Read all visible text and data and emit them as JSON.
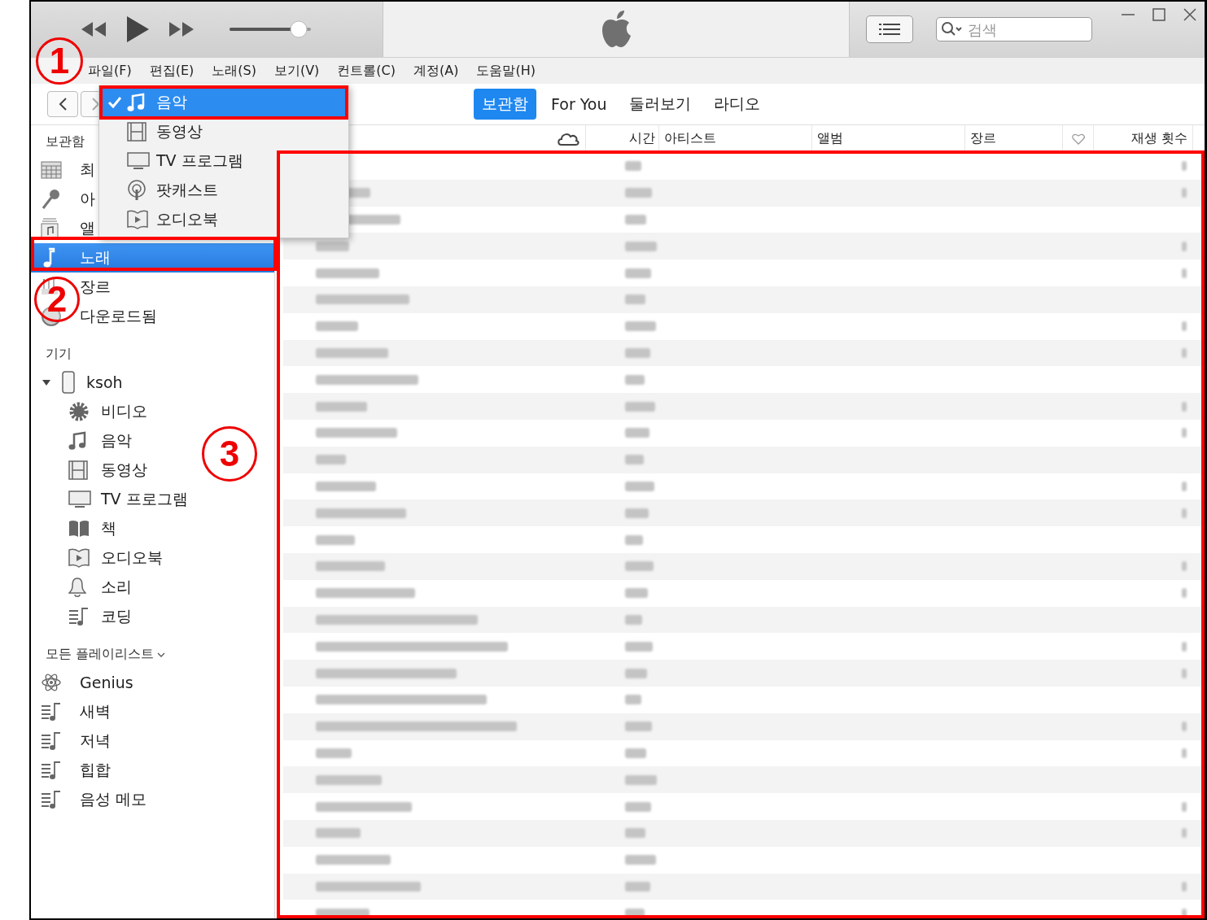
{
  "menu_bar": [
    "파일(F)",
    "편집(E)",
    "노래(S)",
    "보기(V)",
    "컨트롤(C)",
    "계정(A)",
    "도움말(H)"
  ],
  "volume": {
    "level": 0.85
  },
  "search": {
    "placeholder": "검색"
  },
  "tabs": [
    {
      "label": "보관함",
      "selected": true
    },
    {
      "label": "For You",
      "selected": false
    },
    {
      "label": "둘러보기",
      "selected": false
    },
    {
      "label": "라디오",
      "selected": false
    }
  ],
  "media_menu": [
    {
      "label": "음악",
      "kind": "music",
      "checked": true,
      "selected": true
    },
    {
      "label": "동영상",
      "kind": "film",
      "checked": false,
      "selected": false
    },
    {
      "label": "TV 프로그램",
      "kind": "tv",
      "checked": false,
      "selected": false
    },
    {
      "label": "팟캐스트",
      "kind": "podcast",
      "checked": false,
      "selected": false
    },
    {
      "label": "오디오북",
      "kind": "audiobook",
      "checked": false,
      "selected": false
    }
  ],
  "sidebar": {
    "library": {
      "heading": "보관함",
      "items": [
        {
          "label": "최",
          "kind": "grid",
          "selected": false
        },
        {
          "label": "아",
          "kind": "mic",
          "selected": false
        },
        {
          "label": "앨",
          "kind": "album",
          "selected": false
        },
        {
          "label": "노래",
          "kind": "note",
          "selected": true
        },
        {
          "label": "장르",
          "kind": "genre",
          "selected": false
        },
        {
          "label": "다운로드됨",
          "kind": "download",
          "selected": false
        }
      ]
    },
    "devices": {
      "heading": "기기",
      "device": {
        "label": "ksoh",
        "expanded": true,
        "children": [
          {
            "label": "비디오",
            "kind": "gear"
          },
          {
            "label": "음악",
            "kind": "music"
          },
          {
            "label": "동영상",
            "kind": "film"
          },
          {
            "label": "TV 프로그램",
            "kind": "tv"
          },
          {
            "label": "책",
            "kind": "book"
          },
          {
            "label": "오디오북",
            "kind": "audiobook"
          },
          {
            "label": "소리",
            "kind": "bell"
          },
          {
            "label": "코딩",
            "kind": "playlist"
          }
        ]
      }
    },
    "playlists": {
      "heading": "모든 플레이리스트",
      "items": [
        {
          "label": "Genius",
          "kind": "atom"
        },
        {
          "label": "새벽",
          "kind": "playlist"
        },
        {
          "label": "저녁",
          "kind": "playlist"
        },
        {
          "label": "힙합",
          "kind": "playlist"
        },
        {
          "label": "음성 메모",
          "kind": "playlist"
        }
      ]
    }
  },
  "table": {
    "columns": [
      {
        "kind": "cloud"
      },
      {
        "label": "시간",
        "kind": "text"
      },
      {
        "label": "아티스트",
        "kind": "text"
      },
      {
        "label": "앨범",
        "kind": "text"
      },
      {
        "label": "장르",
        "kind": "text"
      },
      {
        "kind": "heart"
      },
      {
        "label": "재생 횟수",
        "kind": "text"
      }
    ]
  },
  "annotations": [
    {
      "label": "1"
    },
    {
      "label": "2"
    },
    {
      "label": "3"
    }
  ]
}
